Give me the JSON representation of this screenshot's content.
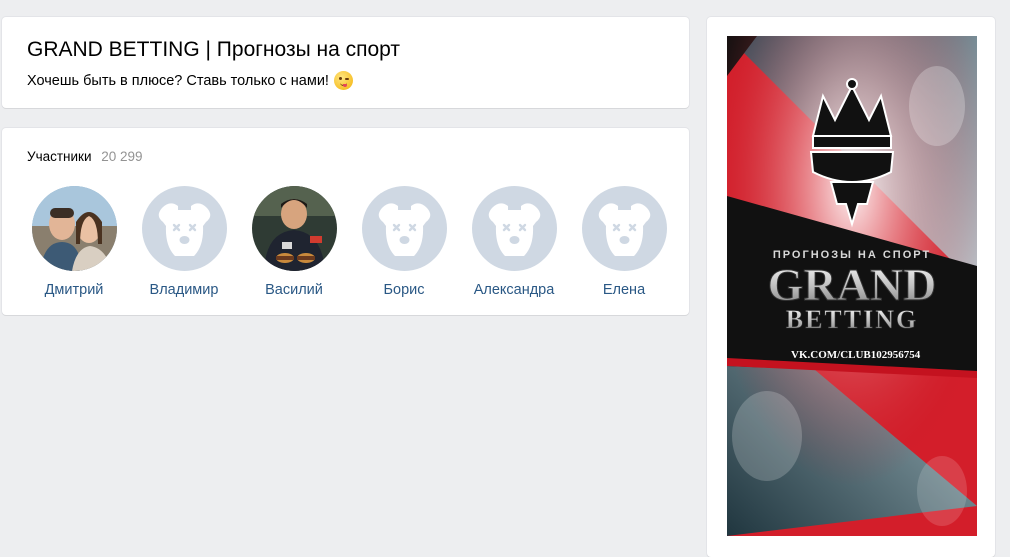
{
  "group": {
    "title": "GRAND BETTING | Прогнозы на спорт",
    "status": "Хочешь быть в плюсе? Ставь только с нами!",
    "status_emoji": "winking-face-with-tongue-icon"
  },
  "members": {
    "label": "Участники",
    "count": "20 299",
    "items": [
      {
        "name": "Дмитрий",
        "avatar": "photo"
      },
      {
        "name": "Владимир",
        "avatar": "default-dog-icon"
      },
      {
        "name": "Василий",
        "avatar": "photo"
      },
      {
        "name": "Борис",
        "avatar": "default-dog-icon"
      },
      {
        "name": "Александра",
        "avatar": "default-dog-icon"
      },
      {
        "name": "Елена",
        "avatar": "default-dog-icon"
      }
    ]
  },
  "cover": {
    "subtitle": "ПРОГНОЗЫ НА СПОРТ",
    "title_line1": "GRAND",
    "title_line2": "BETTING",
    "url": "VK.COM/CLUB102956754"
  },
  "colors": {
    "page_bg": "#edeef0",
    "link": "#2a5885",
    "muted": "#939393",
    "default_avatar": "#cfd8e3",
    "cover_red": "#d31e2a",
    "cover_dark": "#111111"
  }
}
